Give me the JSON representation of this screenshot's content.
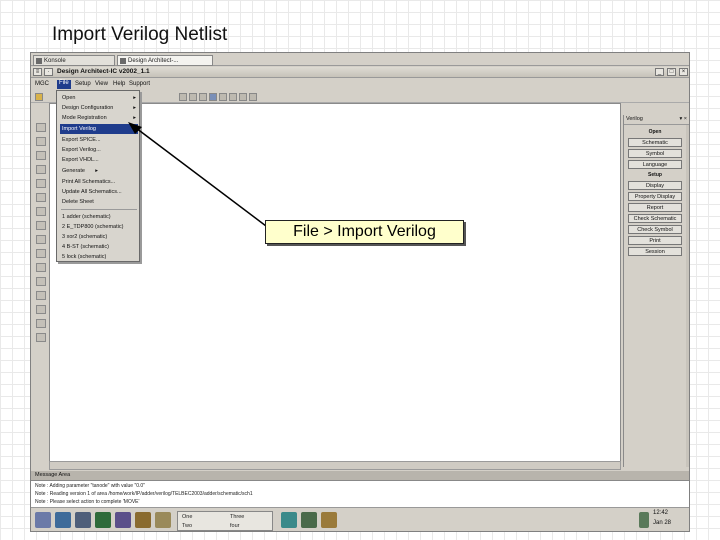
{
  "slide": {
    "title": "Import Verilog Netlist"
  },
  "callout": "File > Import Verilog",
  "window": {
    "tabs": [
      "Konsole",
      "Design Architect-..."
    ],
    "title": "Design Architect-IC v2002_1.1",
    "menus": [
      "MGC",
      "File",
      "Setup",
      "View",
      "Help",
      "Support"
    ],
    "active_menu": "File"
  },
  "file_menu": {
    "items": [
      {
        "label": "Open",
        "submenu": true
      },
      {
        "label": "Design Configuration",
        "submenu": true
      },
      {
        "label": "Mode Registration",
        "submenu": true
      },
      {
        "label": "Import Verilog",
        "submenu": true,
        "selected": true
      },
      {
        "label": "Export SPICE..."
      },
      {
        "label": "Export Verilog..."
      },
      {
        "label": "Export VHDL..."
      },
      {
        "label": "Generate",
        "submenu": true
      },
      {
        "label": "Print All Schematics..."
      },
      {
        "label": "Update All Schematics..."
      },
      {
        "label": "Delete Sheet"
      },
      {
        "label": "1 adder (schematic)"
      },
      {
        "label": "2 E_TDP800 (schematic)"
      },
      {
        "label": "3 xor2 (schematic)"
      },
      {
        "label": "4 B-ST (schematic)"
      },
      {
        "label": "5 lock (schematic)"
      }
    ]
  },
  "right_panel": {
    "header": "Verilog",
    "sections": [
      {
        "title": "Open",
        "buttons": [
          "Schematic",
          "Symbol",
          "Language"
        ]
      },
      {
        "title": "Setup",
        "buttons": [
          "Display",
          "Property Display",
          "Report",
          "Check Schematic",
          "Check Symbol",
          "Print",
          "Session"
        ]
      }
    ]
  },
  "message_area": {
    "header": "Message Area",
    "lines": [
      "Note : Adding parameter \"tanode\" with value \"0.0\"",
      "Note : Reading version 1 of area /home/work/IP/adder/verilog/TELBEC2003/adder/schematic/sch1",
      "Note : Please select action to complete 'MOVE'"
    ]
  },
  "taskbar": {
    "pager": [
      "One",
      "Three",
      "Two",
      "four"
    ],
    "clock_time": "12:42",
    "clock_date": "Jan 28"
  }
}
